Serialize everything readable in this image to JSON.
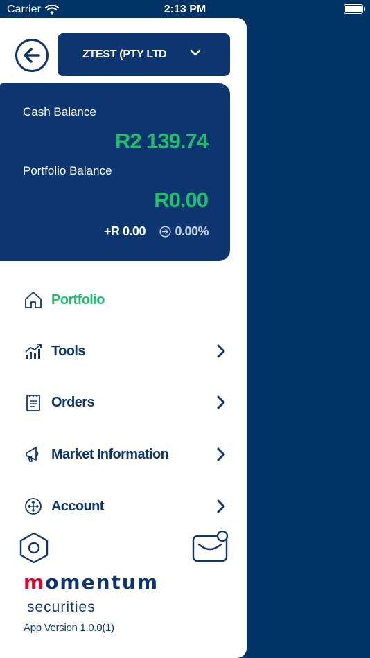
{
  "status_bar": {
    "carrier": "Carrier",
    "time": "2:13 PM"
  },
  "header": {
    "account_name": "ZTEST (PTY LTD"
  },
  "balance": {
    "cash_label": "Cash Balance",
    "cash_value": "R2 139.74",
    "portfolio_label": "Portfolio Balance",
    "portfolio_value": "R0.00",
    "change_value": "+R 0.00",
    "change_percent": "0.00%"
  },
  "menu": {
    "items": [
      {
        "label": "Portfolio",
        "icon": "home-icon",
        "active": true
      },
      {
        "label": "Tools",
        "icon": "chart-icon",
        "active": false
      },
      {
        "label": "Orders",
        "icon": "clipboard-icon",
        "active": false
      },
      {
        "label": "Market Information",
        "icon": "megaphone-icon",
        "active": false
      },
      {
        "label": "Account",
        "icon": "move-icon",
        "active": false
      }
    ]
  },
  "footer": {
    "logo_text": "momentum",
    "logo_sub": "securities",
    "app_version": "App Version 1.0.0(1)"
  },
  "colors": {
    "navy": "#0d3670",
    "background": "#003366",
    "accent_green": "#1fbf6e",
    "brand_red": "#c8102e"
  }
}
